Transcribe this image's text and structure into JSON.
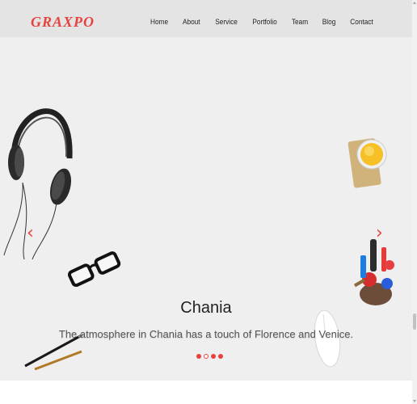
{
  "brand": {
    "logo": "GRAXPO",
    "accent": "#e6433f"
  },
  "nav": {
    "items": [
      "Home",
      "About",
      "Service",
      "Portfolio",
      "Team",
      "Blog",
      "Contact"
    ]
  },
  "slider": {
    "caption_title": "Chania",
    "caption_text": "The atmosphere in Chania has a touch of Florence and Venice.",
    "prev_arrow": "‹",
    "next_arrow": "›",
    "indicators": 4,
    "active_indicator": 2
  }
}
